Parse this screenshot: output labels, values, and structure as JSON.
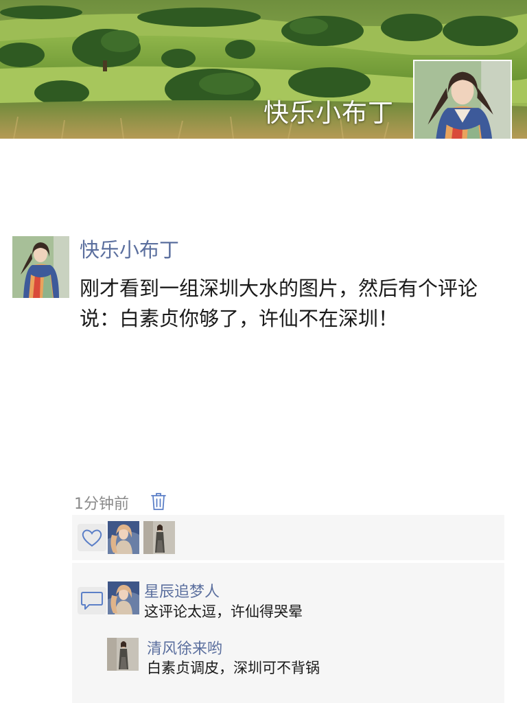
{
  "profile": {
    "name": "快乐小布丁"
  },
  "post": {
    "author": "快乐小布丁",
    "text": "刚才看到一组深圳大水的图片，然后有个评论说：白素贞你够了，许仙不在深圳！",
    "time": "1分钟前"
  },
  "likes": {
    "users": [
      "liker-1",
      "liker-2"
    ]
  },
  "comments": [
    {
      "user": "星辰追梦人",
      "text": "这评论太逗，许仙得哭晕"
    },
    {
      "user": "清风徐来哟",
      "text": "白素贞调皮，深圳可不背锅"
    }
  ],
  "icons": {
    "delete": "trash-icon",
    "like": "heart-icon",
    "comment": "comment-bubble-icon"
  },
  "colors": {
    "name_link": "#5b6f9e",
    "text": "#1a1a1a",
    "meta": "#8a8a8a",
    "panel": "#f6f6f6"
  }
}
